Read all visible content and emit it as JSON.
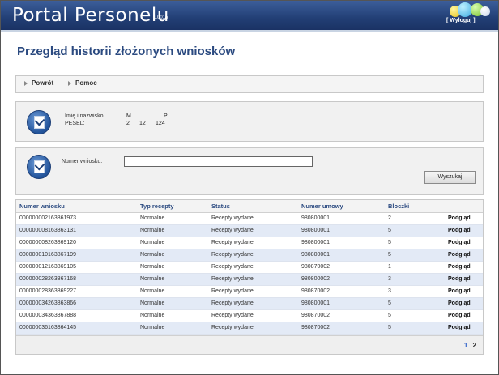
{
  "header": {
    "title": "Portal Personelu",
    "version": "1.0015",
    "logout_label": "[ Wyloguj ]",
    "color": "#223f75"
  },
  "page": {
    "title": "Przegląd historii złożonych wniosków"
  },
  "toolbar": {
    "back_label": "Powrót",
    "help_label": "Pomoc"
  },
  "person": {
    "name_label": "Imię i nazwisko:",
    "pesel_label": "PESEL:",
    "name_parts": [
      "M",
      "P"
    ],
    "pesel_parts": [
      "2",
      "12",
      "124"
    ]
  },
  "search": {
    "label": "Numer wniosku:",
    "value": "",
    "button_label": "Wyszukaj"
  },
  "table": {
    "columns": [
      "Numer wniosku",
      "Typ recepty",
      "Status",
      "Numer umowy",
      "Bloczki",
      ""
    ],
    "rows": [
      [
        "000000002163861973",
        "Normalne",
        "Recepty wydane",
        "980800001",
        "2",
        "Podgląd"
      ],
      [
        "000000008163863131",
        "Normalne",
        "Recepty wydane",
        "980800001",
        "5",
        "Podgląd"
      ],
      [
        "000000008263869120",
        "Normalne",
        "Recepty wydane",
        "980800001",
        "5",
        "Podgląd"
      ],
      [
        "000000010163867199",
        "Normalne",
        "Recepty wydane",
        "980800001",
        "5",
        "Podgląd"
      ],
      [
        "000000012163869105",
        "Normalne",
        "Recepty wydane",
        "980870002",
        "1",
        "Podgląd"
      ],
      [
        "000000028263867168",
        "Normalne",
        "Recepty wydane",
        "980800002",
        "3",
        "Podgląd"
      ],
      [
        "000000028363869227",
        "Normalne",
        "Recepty wydane",
        "980870002",
        "3",
        "Podgląd"
      ],
      [
        "000000034263863866",
        "Normalne",
        "Recepty wydane",
        "980800001",
        "5",
        "Podgląd"
      ],
      [
        "000000034363867888",
        "Normalne",
        "Recepty wydane",
        "980870002",
        "5",
        "Podgląd"
      ],
      [
        "000000036163864145",
        "Normalne",
        "Recepty wydane",
        "980870002",
        "5",
        "Podgląd"
      ]
    ]
  },
  "pagination": {
    "pages": [
      "1",
      "2"
    ],
    "current": "1"
  }
}
